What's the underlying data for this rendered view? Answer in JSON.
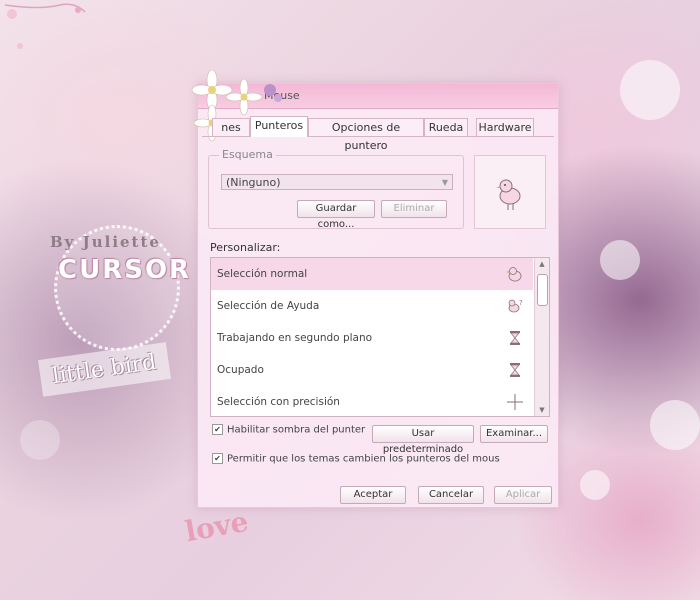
{
  "window": {
    "title": "Mouse",
    "tabs": [
      {
        "label": "nes",
        "active": false
      },
      {
        "label": "Punteros",
        "active": true
      },
      {
        "label": "Opciones de puntero",
        "active": false
      },
      {
        "label": "Rueda",
        "active": false
      },
      {
        "label": "Hardware",
        "active": false
      }
    ]
  },
  "scheme": {
    "legend": "Esquema",
    "selected": "(Ninguno)",
    "save_label": "Guardar como...",
    "delete_label": "Eliminar"
  },
  "customize": {
    "label": "Personalizar:",
    "items": [
      {
        "label": "Selección normal",
        "selected": true
      },
      {
        "label": "Selección de Ayuda",
        "selected": false
      },
      {
        "label": "Trabajando en segundo plano",
        "selected": false
      },
      {
        "label": "Ocupado",
        "selected": false
      },
      {
        "label": "Selección con precisión",
        "selected": false
      }
    ]
  },
  "options": {
    "shadow_label": "Habilitar sombra del punter",
    "shadow_checked": true,
    "default_label": "Usar predeterminado",
    "browse_label": "Examinar...",
    "themes_label": "Permitir que los temas cambien los punteros del mous",
    "themes_checked": true
  },
  "footer": {
    "ok_label": "Aceptar",
    "cancel_label": "Cancelar",
    "apply_label": "Aplicar"
  },
  "branding": {
    "by": "By Juliette",
    "name": "CURSOR",
    "tagline": "little bird",
    "love": "love"
  },
  "colors": {
    "accent": "#f4b8d6",
    "selection": "#f6d8e8",
    "window_bg": "#fae8f4"
  }
}
